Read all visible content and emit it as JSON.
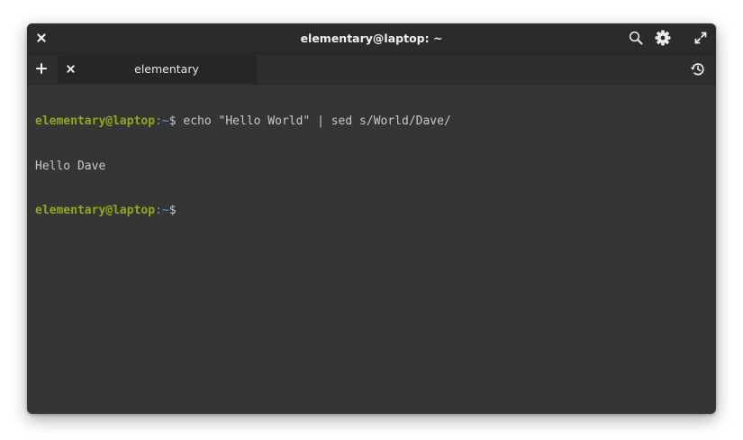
{
  "window": {
    "title": "elementary@laptop: ~"
  },
  "titlebar": {
    "close_icon": "close-icon",
    "search_icon": "search-icon",
    "settings_icon": "gear-icon",
    "maximize_icon": "maximize-icon"
  },
  "tabs": {
    "new_tab_icon": "plus-icon",
    "history_icon": "history-icon",
    "items": [
      {
        "label": "elementary",
        "close_icon": "close-icon"
      }
    ]
  },
  "terminal": {
    "lines": [
      {
        "user": "elementary@laptop",
        "sep": ":~",
        "dollar": "$",
        "command": " echo \"Hello World\" | sed s/World/Dave/"
      },
      {
        "output": "Hello Dave"
      },
      {
        "user": "elementary@laptop",
        "sep": ":~",
        "dollar": "$",
        "command": ""
      }
    ]
  },
  "colors": {
    "background": "#353535",
    "titlebar": "#2b2b2b",
    "prompt_user": "#8fa81e",
    "prompt_path": "#5a9ad1",
    "text": "#c8c8c8"
  }
}
